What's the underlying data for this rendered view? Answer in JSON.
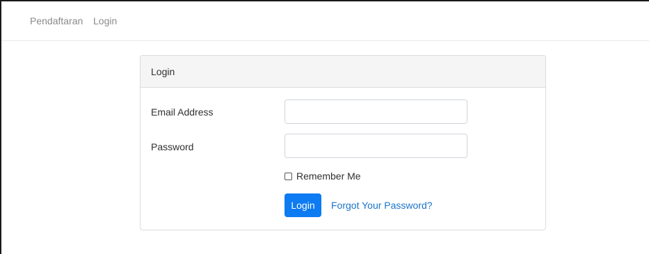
{
  "nav": {
    "items": [
      {
        "label": "Pendaftaran"
      },
      {
        "label": "Login"
      }
    ]
  },
  "card": {
    "header": "Login",
    "email_label": "Email Address",
    "email_value": "",
    "password_label": "Password",
    "password_value": "",
    "remember_label": "Remember Me",
    "remember_checked": false,
    "login_button": "Login",
    "forgot_link": "Forgot Your Password?"
  },
  "colors": {
    "primary": "#0d7bf2",
    "link": "#1a73c9",
    "nav_text": "#8a8a8a"
  }
}
